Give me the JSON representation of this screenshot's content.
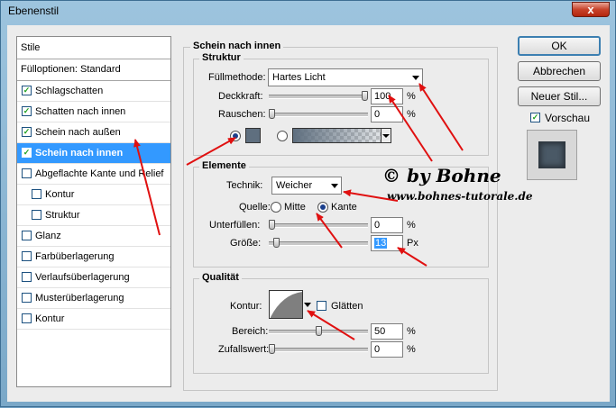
{
  "window": {
    "title": "Ebenenstil",
    "close_glyph": "x"
  },
  "styles": {
    "header": "Stile",
    "fill_options": "Fülloptionen: Standard",
    "items": [
      {
        "label": "Schlagschatten",
        "checked": true,
        "selected": false,
        "indent": false
      },
      {
        "label": "Schatten nach innen",
        "checked": true,
        "selected": false,
        "indent": false
      },
      {
        "label": "Schein nach außen",
        "checked": true,
        "selected": false,
        "indent": false
      },
      {
        "label": "Schein nach innen",
        "checked": true,
        "selected": true,
        "indent": false
      },
      {
        "label": "Abgeflachte Kante und Relief",
        "checked": false,
        "selected": false,
        "indent": false
      },
      {
        "label": "Kontur",
        "checked": false,
        "selected": false,
        "indent": true
      },
      {
        "label": "Struktur",
        "checked": false,
        "selected": false,
        "indent": true
      },
      {
        "label": "Glanz",
        "checked": false,
        "selected": false,
        "indent": false
      },
      {
        "label": "Farbüberlagerung",
        "checked": false,
        "selected": false,
        "indent": false
      },
      {
        "label": "Verlaufsüberlagerung",
        "checked": false,
        "selected": false,
        "indent": false
      },
      {
        "label": "Musterüberlagerung",
        "checked": false,
        "selected": false,
        "indent": false
      },
      {
        "label": "Kontur",
        "checked": false,
        "selected": false,
        "indent": false
      }
    ]
  },
  "panel": {
    "title": "Schein nach innen",
    "struktur": {
      "legend": "Struktur",
      "blend_label": "Füllmethode:",
      "blend_value": "Hartes Licht",
      "opacity_label": "Deckkraft:",
      "opacity_value": "100",
      "opacity_fraction": 1.0,
      "noise_label": "Rauschen:",
      "noise_value": "0",
      "noise_fraction": 0.0,
      "unit_percent": "%",
      "glow_color": "#5f6f7f"
    },
    "elemente": {
      "legend": "Elemente",
      "technique_label": "Technik:",
      "technique_value": "Weicher",
      "source_label": "Quelle:",
      "source_center": "Mitte",
      "source_edge": "Kante",
      "choke_label": "Unterfüllen:",
      "choke_value": "0",
      "choke_fraction": 0.0,
      "size_label": "Größe:",
      "size_value": "13",
      "size_fraction": 0.05,
      "unit_px": "Px",
      "unit_percent": "%"
    },
    "qualitaet": {
      "legend": "Qualität",
      "contour_label": "Kontur:",
      "antialias_label": "Glätten",
      "range_label": "Bereich:",
      "range_value": "50",
      "range_fraction": 0.5,
      "jitter_label": "Zufallswert:",
      "jitter_value": "0",
      "jitter_fraction": 0.0,
      "unit_percent": "%"
    }
  },
  "buttons": {
    "ok": "OK",
    "cancel": "Abbrechen",
    "new_style": "Neuer Stil...",
    "preview_label": "Vorschau",
    "preview_checked": true
  },
  "watermark": {
    "line1": "© by Bohne",
    "line2": "www.bohnes-tutorale.de"
  },
  "colors": {
    "selection": "#3399ff",
    "annotation_arrow": "#e01010"
  }
}
